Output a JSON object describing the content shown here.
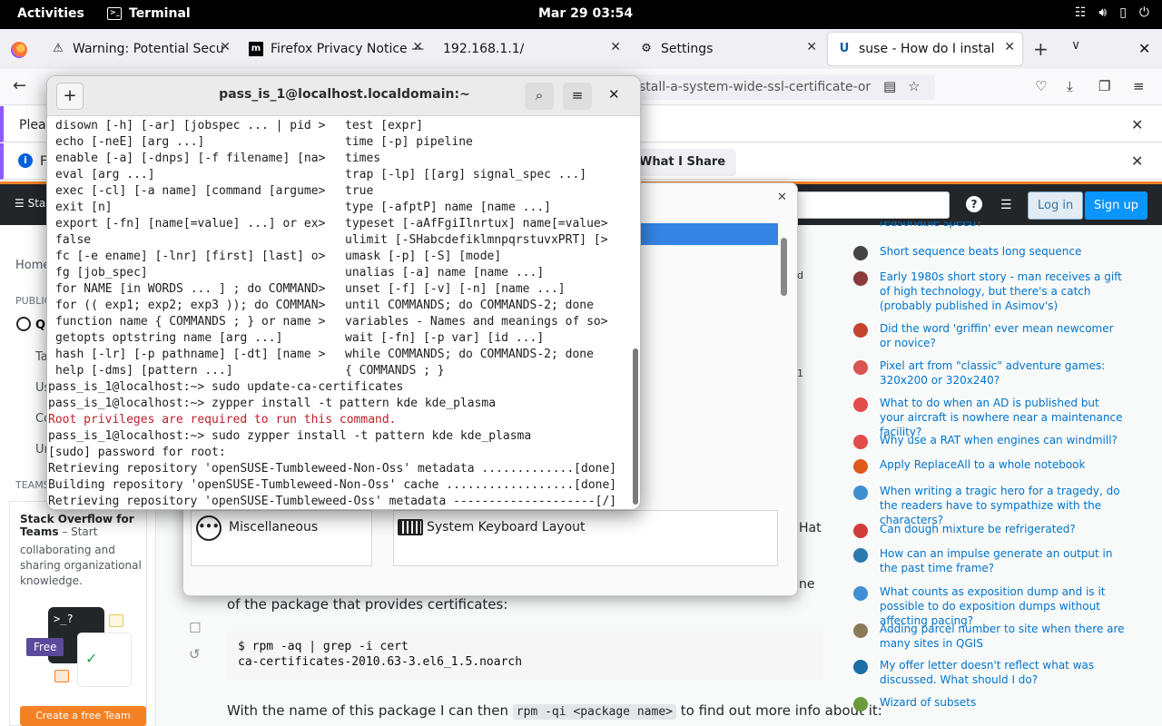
{
  "topbar": {
    "activities": "Activities",
    "app_name": "Terminal",
    "clock": "Mar 29  03:54"
  },
  "browser": {
    "tabs": [
      {
        "title": "Warning: Potential Secu",
        "icon": "warning-icon"
      },
      {
        "title": "Firefox Privacy Notice —",
        "icon": "mozilla-icon"
      },
      {
        "title": "192.168.1.1/",
        "icon": "blank-icon"
      },
      {
        "title": "Settings",
        "icon": "gear-icon"
      },
      {
        "title": "suse - How do I install a",
        "icon": "unix-se-icon"
      }
    ],
    "url_fragment": "stall-a-system-wide-ssl-certificate-or",
    "notice1_text": "Pleas",
    "notice2_text": "F",
    "notice2_button": "What I Share"
  },
  "so": {
    "menu_fragment": "Sta",
    "login": "Log in",
    "signup": "Sign up",
    "left_nav": {
      "home": "Home",
      "public": "PUBLIC",
      "questions_frag": "Q",
      "tags_frag": "Ta",
      "users_frag": "Us",
      "companies_frag": "Co",
      "unanswered_frag": "Ur",
      "teams": "TEAMS",
      "teams_title_1": "Stack Overflow for",
      "teams_title_2": "Teams",
      "teams_desc_1": " – Start",
      "teams_desc_2": "collaborating and sharing organizational knowledge.",
      "free": "Free",
      "prompt": ">_?",
      "cta": "Create a free Team"
    },
    "post": {
      "frag_hat": "Hat",
      "frag_ne": "ne",
      "frag_d": "d",
      "frag_1": "1",
      "line1": "of the package that provides certificates:",
      "code": "$ rpm -aq | grep -i cert\nca-certificates-2010.63-3.el6_1.5.noarch",
      "line2_pre": "With the name of this package I can then ",
      "line2_code": "rpm -qi <package name>",
      "line2_post": " to find out more info about it:"
    },
    "hot_questions": [
      {
        "title": "reasonable speed?",
        "icon": "site-icon",
        "color": "#888888"
      },
      {
        "title": "Short sequence beats long sequence",
        "icon": "mo-icon",
        "color": "#444444"
      },
      {
        "title": "Early 1980s short story - man receives a gift of high technology, but there's a catch (probably published in Asimov's)",
        "icon": "scifi-icon",
        "color": "#8a3a3a"
      },
      {
        "title": "Did the word 'griffin' ever mean newcomer or novice?",
        "icon": "ell-icon",
        "color": "#c4432f"
      },
      {
        "title": "Pixel art from \"classic\" adventure games: 320x200 or 320x240?",
        "icon": "retro-icon",
        "color": "#d9534f"
      },
      {
        "title": "What to do when an AD is published but your aircraft is nowhere near a maintenance facility?",
        "icon": "aviation-icon",
        "color": "#e24c4b"
      },
      {
        "title": "Why use a RAT when engines can windmill?",
        "icon": "aviation-icon",
        "color": "#e24c4b"
      },
      {
        "title": "Apply ReplaceAll to a whole notebook",
        "icon": "mathematica-icon",
        "color": "#e05a1a"
      },
      {
        "title": "When writing a tragic hero for a tragedy, do the readers have to sympathize with the characters?",
        "icon": "writing-icon",
        "color": "#3f8fd2"
      },
      {
        "title": "Can dough mixture be refrigerated?",
        "icon": "cooking-icon",
        "color": "#d13b3b"
      },
      {
        "title": "How can an impulse generate an output in the past time frame?",
        "icon": "dsp-icon",
        "color": "#2a7ab0"
      },
      {
        "title": "What counts as exposition dump and is it possible to do exposition dumps without affecting pacing?",
        "icon": "writing-icon",
        "color": "#3f8fd2"
      },
      {
        "title": "Adding parcel number to site when there are many sites in QGIS",
        "icon": "gis-icon",
        "color": "#8a7a5a"
      },
      {
        "title": "My offer letter doesn't reflect what was discussed. What should I do?",
        "icon": "workplace-icon",
        "color": "#1e6ea7"
      },
      {
        "title": "Wizard of subsets",
        "icon": "puzzling-icon",
        "color": "#6a9a3a"
      }
    ]
  },
  "settings": {
    "misc_label": "Miscellaneous",
    "kbd_label": "System Keyboard Layout"
  },
  "terminal": {
    "title": "pass_is_1@localhost.localdomain:~",
    "lines_left": [
      "disown [-h] [-ar] [jobspec ... | pid >",
      "echo [-neE] [arg ...]",
      "enable [-a] [-dnps] [-f filename] [na>",
      "eval [arg ...]",
      "exec [-cl] [-a name] [command [argume>",
      "exit [n]",
      "export [-fn] [name[=value] ...] or ex>",
      "false",
      "fc [-e ename] [-lnr] [first] [last] o>",
      "fg [job_spec]",
      "for NAME [in WORDS ... ] ; do COMMAND>",
      "for (( exp1; exp2; exp3 )); do COMMAN>",
      "function name { COMMANDS ; } or name >",
      "getopts optstring name [arg ...]",
      "hash [-lr] [-p pathname] [-dt] [name >",
      "help [-dms] [pattern ...]"
    ],
    "lines_right": [
      "test [expr]",
      "time [-p] pipeline",
      "times",
      "trap [-lp] [[arg] signal_spec ...]",
      "true",
      "type [-afptP] name [name ...]",
      "typeset [-aAfFgiIlnrtux] name[=value>",
      "ulimit [-SHabcdefiklmnpqrstuvxPRT] [>",
      "umask [-p] [-S] [mode]",
      "unalias [-a] name [name ...]",
      "unset [-f] [-v] [-n] [name ...]",
      "until COMMANDS; do COMMANDS-2; done",
      "variables - Names and meanings of so>",
      "wait [-fn] [-p var] [id ...]",
      "while COMMANDS; do COMMANDS-2; done",
      "{ COMMANDS ; }"
    ],
    "lines_bottom": [
      {
        "text": "pass_is_1@localhost:~> sudo update-ca-certificates",
        "error": false
      },
      {
        "text": "pass_is_1@localhost:~> zypper install -t pattern kde kde_plasma",
        "error": false
      },
      {
        "text": "Root privileges are required to run this command.",
        "error": true
      },
      {
        "text": "pass_is_1@localhost:~> sudo zypper install -t pattern kde kde_plasma",
        "error": false
      },
      {
        "text": "[sudo] password for root:",
        "error": false
      },
      {
        "text": "Retrieving repository 'openSUSE-Tumbleweed-Non-Oss' metadata .............[done]",
        "error": false
      },
      {
        "text": "Building repository 'openSUSE-Tumbleweed-Non-Oss' cache ..................[done]",
        "error": false
      },
      {
        "text": "Retrieving repository 'openSUSE-Tumbleweed-Oss' metadata --------------------[/]",
        "error": false
      }
    ]
  }
}
